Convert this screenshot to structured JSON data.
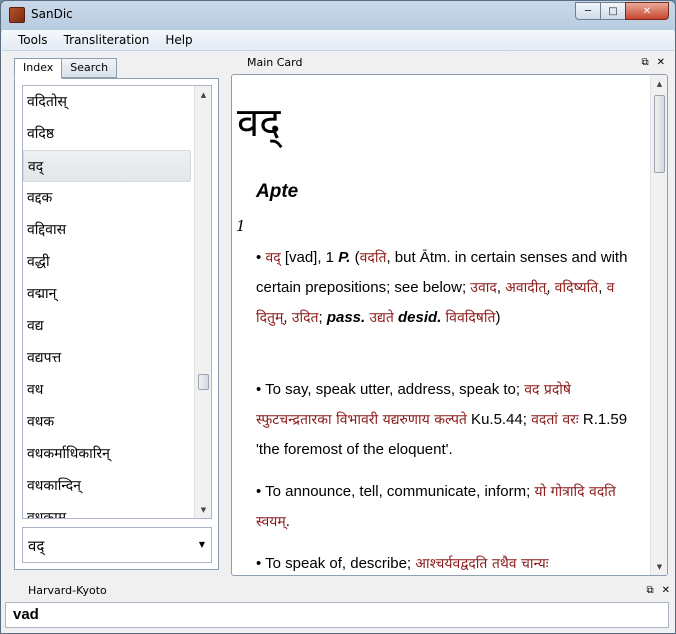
{
  "window": {
    "title": "SanDic",
    "minimize": "─",
    "maximize": "□",
    "close": "✕"
  },
  "menu": [
    "Tools",
    "Transliteration",
    "Help"
  ],
  "left_tabs": [
    "Index",
    "Search"
  ],
  "index": {
    "items": [
      "वदितोस्",
      "वदिष्ठ",
      "वद्",
      "वद्दक",
      "वद्दिवास",
      "वद्धी",
      "वद्मान्",
      "वद्य",
      "वद्यपत्त",
      "वध",
      "वधक",
      "वधकर्माधिकारिन्",
      "वधकान्दिन्",
      "वधकाम"
    ],
    "selected_index": 2,
    "combo_value": "वद्"
  },
  "main_card": {
    "dock_title": "Main Card",
    "headword": "वद्",
    "dictionary": "Apte",
    "sense_number": "1",
    "senses": [
      {
        "bullet": "•",
        "parts": [
          {
            "t": "वद्",
            "dev": true
          },
          {
            "t": " [vad], 1 "
          },
          {
            "t": "P.",
            "bi": true
          },
          {
            "t": " ("
          },
          {
            "t": "वदति",
            "dev": true
          },
          {
            "t": ", but Ātm. in certain senses and with certain prepositions; see below; "
          },
          {
            "t": "उवाद",
            "dev": true
          },
          {
            "t": ", "
          },
          {
            "t": "अवादीत्",
            "dev": true
          },
          {
            "t": ", "
          },
          {
            "t": "वदिष्यति",
            "dev": true
          },
          {
            "t": ", "
          },
          {
            "t": "व दितुम्",
            "dev": true
          },
          {
            "t": ", "
          },
          {
            "t": "उदित",
            "dev": true
          },
          {
            "t": "; "
          },
          {
            "t": "pass.",
            "bi": true
          },
          {
            "t": " "
          },
          {
            "t": "उद्यते",
            "dev": true
          },
          {
            "t": " "
          },
          {
            "t": "desid.",
            "bi": true
          },
          {
            "t": " "
          },
          {
            "t": "विवदिषति",
            "dev": true
          },
          {
            "t": ")"
          }
        ]
      },
      {
        "bullet": "•",
        "parts": [
          {
            "t": "To say, speak utter, address, speak to; "
          },
          {
            "t": "वद प्रदोषे स्फुटचन्द्रतारका विभावरी यद्यरुणाय कल्पते",
            "dev": true
          },
          {
            "t": " Ku.5.44; "
          },
          {
            "t": "वदतां वरः",
            "dev": true
          },
          {
            "t": " R.1.59 'the foremost of the eloquent'."
          }
        ]
      },
      {
        "bullet": "•",
        "parts": [
          {
            "t": "To announce, tell, communicate, inform; "
          },
          {
            "t": "यो गोत्रादि वदति स्वयम्",
            "dev": true
          },
          {
            "t": "."
          }
        ]
      },
      {
        "bullet": "•",
        "parts": [
          {
            "t": "To speak of, describe; "
          },
          {
            "t": "आश्चर्यवद्वदति तथैव चान्यः",
            "dev": true
          }
        ]
      }
    ]
  },
  "transliteration": {
    "dock_title": "Harvard-Kyoto",
    "value": "vad"
  },
  "dock_icons": {
    "float": "⧉",
    "close": "✕"
  },
  "colors": {
    "devanagari": "#8b1a1a"
  }
}
